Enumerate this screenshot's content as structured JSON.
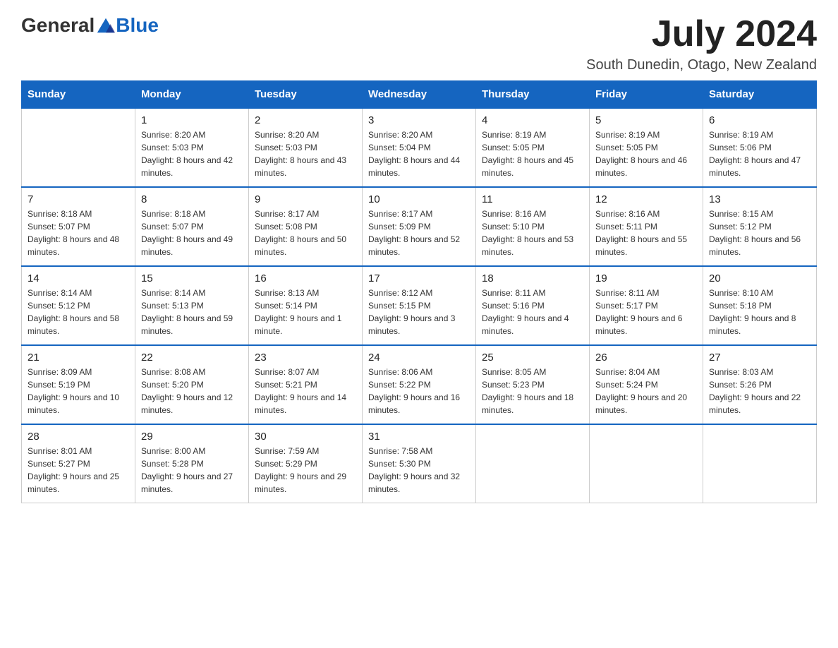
{
  "header": {
    "logo_general": "General",
    "logo_blue": "Blue",
    "month_year": "July 2024",
    "location": "South Dunedin, Otago, New Zealand"
  },
  "days_of_week": [
    "Sunday",
    "Monday",
    "Tuesday",
    "Wednesday",
    "Thursday",
    "Friday",
    "Saturday"
  ],
  "weeks": [
    [
      {
        "day": "",
        "sunrise": "",
        "sunset": "",
        "daylight": ""
      },
      {
        "day": "1",
        "sunrise": "Sunrise: 8:20 AM",
        "sunset": "Sunset: 5:03 PM",
        "daylight": "Daylight: 8 hours and 42 minutes."
      },
      {
        "day": "2",
        "sunrise": "Sunrise: 8:20 AM",
        "sunset": "Sunset: 5:03 PM",
        "daylight": "Daylight: 8 hours and 43 minutes."
      },
      {
        "day": "3",
        "sunrise": "Sunrise: 8:20 AM",
        "sunset": "Sunset: 5:04 PM",
        "daylight": "Daylight: 8 hours and 44 minutes."
      },
      {
        "day": "4",
        "sunrise": "Sunrise: 8:19 AM",
        "sunset": "Sunset: 5:05 PM",
        "daylight": "Daylight: 8 hours and 45 minutes."
      },
      {
        "day": "5",
        "sunrise": "Sunrise: 8:19 AM",
        "sunset": "Sunset: 5:05 PM",
        "daylight": "Daylight: 8 hours and 46 minutes."
      },
      {
        "day": "6",
        "sunrise": "Sunrise: 8:19 AM",
        "sunset": "Sunset: 5:06 PM",
        "daylight": "Daylight: 8 hours and 47 minutes."
      }
    ],
    [
      {
        "day": "7",
        "sunrise": "Sunrise: 8:18 AM",
        "sunset": "Sunset: 5:07 PM",
        "daylight": "Daylight: 8 hours and 48 minutes."
      },
      {
        "day": "8",
        "sunrise": "Sunrise: 8:18 AM",
        "sunset": "Sunset: 5:07 PM",
        "daylight": "Daylight: 8 hours and 49 minutes."
      },
      {
        "day": "9",
        "sunrise": "Sunrise: 8:17 AM",
        "sunset": "Sunset: 5:08 PM",
        "daylight": "Daylight: 8 hours and 50 minutes."
      },
      {
        "day": "10",
        "sunrise": "Sunrise: 8:17 AM",
        "sunset": "Sunset: 5:09 PM",
        "daylight": "Daylight: 8 hours and 52 minutes."
      },
      {
        "day": "11",
        "sunrise": "Sunrise: 8:16 AM",
        "sunset": "Sunset: 5:10 PM",
        "daylight": "Daylight: 8 hours and 53 minutes."
      },
      {
        "day": "12",
        "sunrise": "Sunrise: 8:16 AM",
        "sunset": "Sunset: 5:11 PM",
        "daylight": "Daylight: 8 hours and 55 minutes."
      },
      {
        "day": "13",
        "sunrise": "Sunrise: 8:15 AM",
        "sunset": "Sunset: 5:12 PM",
        "daylight": "Daylight: 8 hours and 56 minutes."
      }
    ],
    [
      {
        "day": "14",
        "sunrise": "Sunrise: 8:14 AM",
        "sunset": "Sunset: 5:12 PM",
        "daylight": "Daylight: 8 hours and 58 minutes."
      },
      {
        "day": "15",
        "sunrise": "Sunrise: 8:14 AM",
        "sunset": "Sunset: 5:13 PM",
        "daylight": "Daylight: 8 hours and 59 minutes."
      },
      {
        "day": "16",
        "sunrise": "Sunrise: 8:13 AM",
        "sunset": "Sunset: 5:14 PM",
        "daylight": "Daylight: 9 hours and 1 minute."
      },
      {
        "day": "17",
        "sunrise": "Sunrise: 8:12 AM",
        "sunset": "Sunset: 5:15 PM",
        "daylight": "Daylight: 9 hours and 3 minutes."
      },
      {
        "day": "18",
        "sunrise": "Sunrise: 8:11 AM",
        "sunset": "Sunset: 5:16 PM",
        "daylight": "Daylight: 9 hours and 4 minutes."
      },
      {
        "day": "19",
        "sunrise": "Sunrise: 8:11 AM",
        "sunset": "Sunset: 5:17 PM",
        "daylight": "Daylight: 9 hours and 6 minutes."
      },
      {
        "day": "20",
        "sunrise": "Sunrise: 8:10 AM",
        "sunset": "Sunset: 5:18 PM",
        "daylight": "Daylight: 9 hours and 8 minutes."
      }
    ],
    [
      {
        "day": "21",
        "sunrise": "Sunrise: 8:09 AM",
        "sunset": "Sunset: 5:19 PM",
        "daylight": "Daylight: 9 hours and 10 minutes."
      },
      {
        "day": "22",
        "sunrise": "Sunrise: 8:08 AM",
        "sunset": "Sunset: 5:20 PM",
        "daylight": "Daylight: 9 hours and 12 minutes."
      },
      {
        "day": "23",
        "sunrise": "Sunrise: 8:07 AM",
        "sunset": "Sunset: 5:21 PM",
        "daylight": "Daylight: 9 hours and 14 minutes."
      },
      {
        "day": "24",
        "sunrise": "Sunrise: 8:06 AM",
        "sunset": "Sunset: 5:22 PM",
        "daylight": "Daylight: 9 hours and 16 minutes."
      },
      {
        "day": "25",
        "sunrise": "Sunrise: 8:05 AM",
        "sunset": "Sunset: 5:23 PM",
        "daylight": "Daylight: 9 hours and 18 minutes."
      },
      {
        "day": "26",
        "sunrise": "Sunrise: 8:04 AM",
        "sunset": "Sunset: 5:24 PM",
        "daylight": "Daylight: 9 hours and 20 minutes."
      },
      {
        "day": "27",
        "sunrise": "Sunrise: 8:03 AM",
        "sunset": "Sunset: 5:26 PM",
        "daylight": "Daylight: 9 hours and 22 minutes."
      }
    ],
    [
      {
        "day": "28",
        "sunrise": "Sunrise: 8:01 AM",
        "sunset": "Sunset: 5:27 PM",
        "daylight": "Daylight: 9 hours and 25 minutes."
      },
      {
        "day": "29",
        "sunrise": "Sunrise: 8:00 AM",
        "sunset": "Sunset: 5:28 PM",
        "daylight": "Daylight: 9 hours and 27 minutes."
      },
      {
        "day": "30",
        "sunrise": "Sunrise: 7:59 AM",
        "sunset": "Sunset: 5:29 PM",
        "daylight": "Daylight: 9 hours and 29 minutes."
      },
      {
        "day": "31",
        "sunrise": "Sunrise: 7:58 AM",
        "sunset": "Sunset: 5:30 PM",
        "daylight": "Daylight: 9 hours and 32 minutes."
      },
      {
        "day": "",
        "sunrise": "",
        "sunset": "",
        "daylight": ""
      },
      {
        "day": "",
        "sunrise": "",
        "sunset": "",
        "daylight": ""
      },
      {
        "day": "",
        "sunrise": "",
        "sunset": "",
        "daylight": ""
      }
    ]
  ]
}
